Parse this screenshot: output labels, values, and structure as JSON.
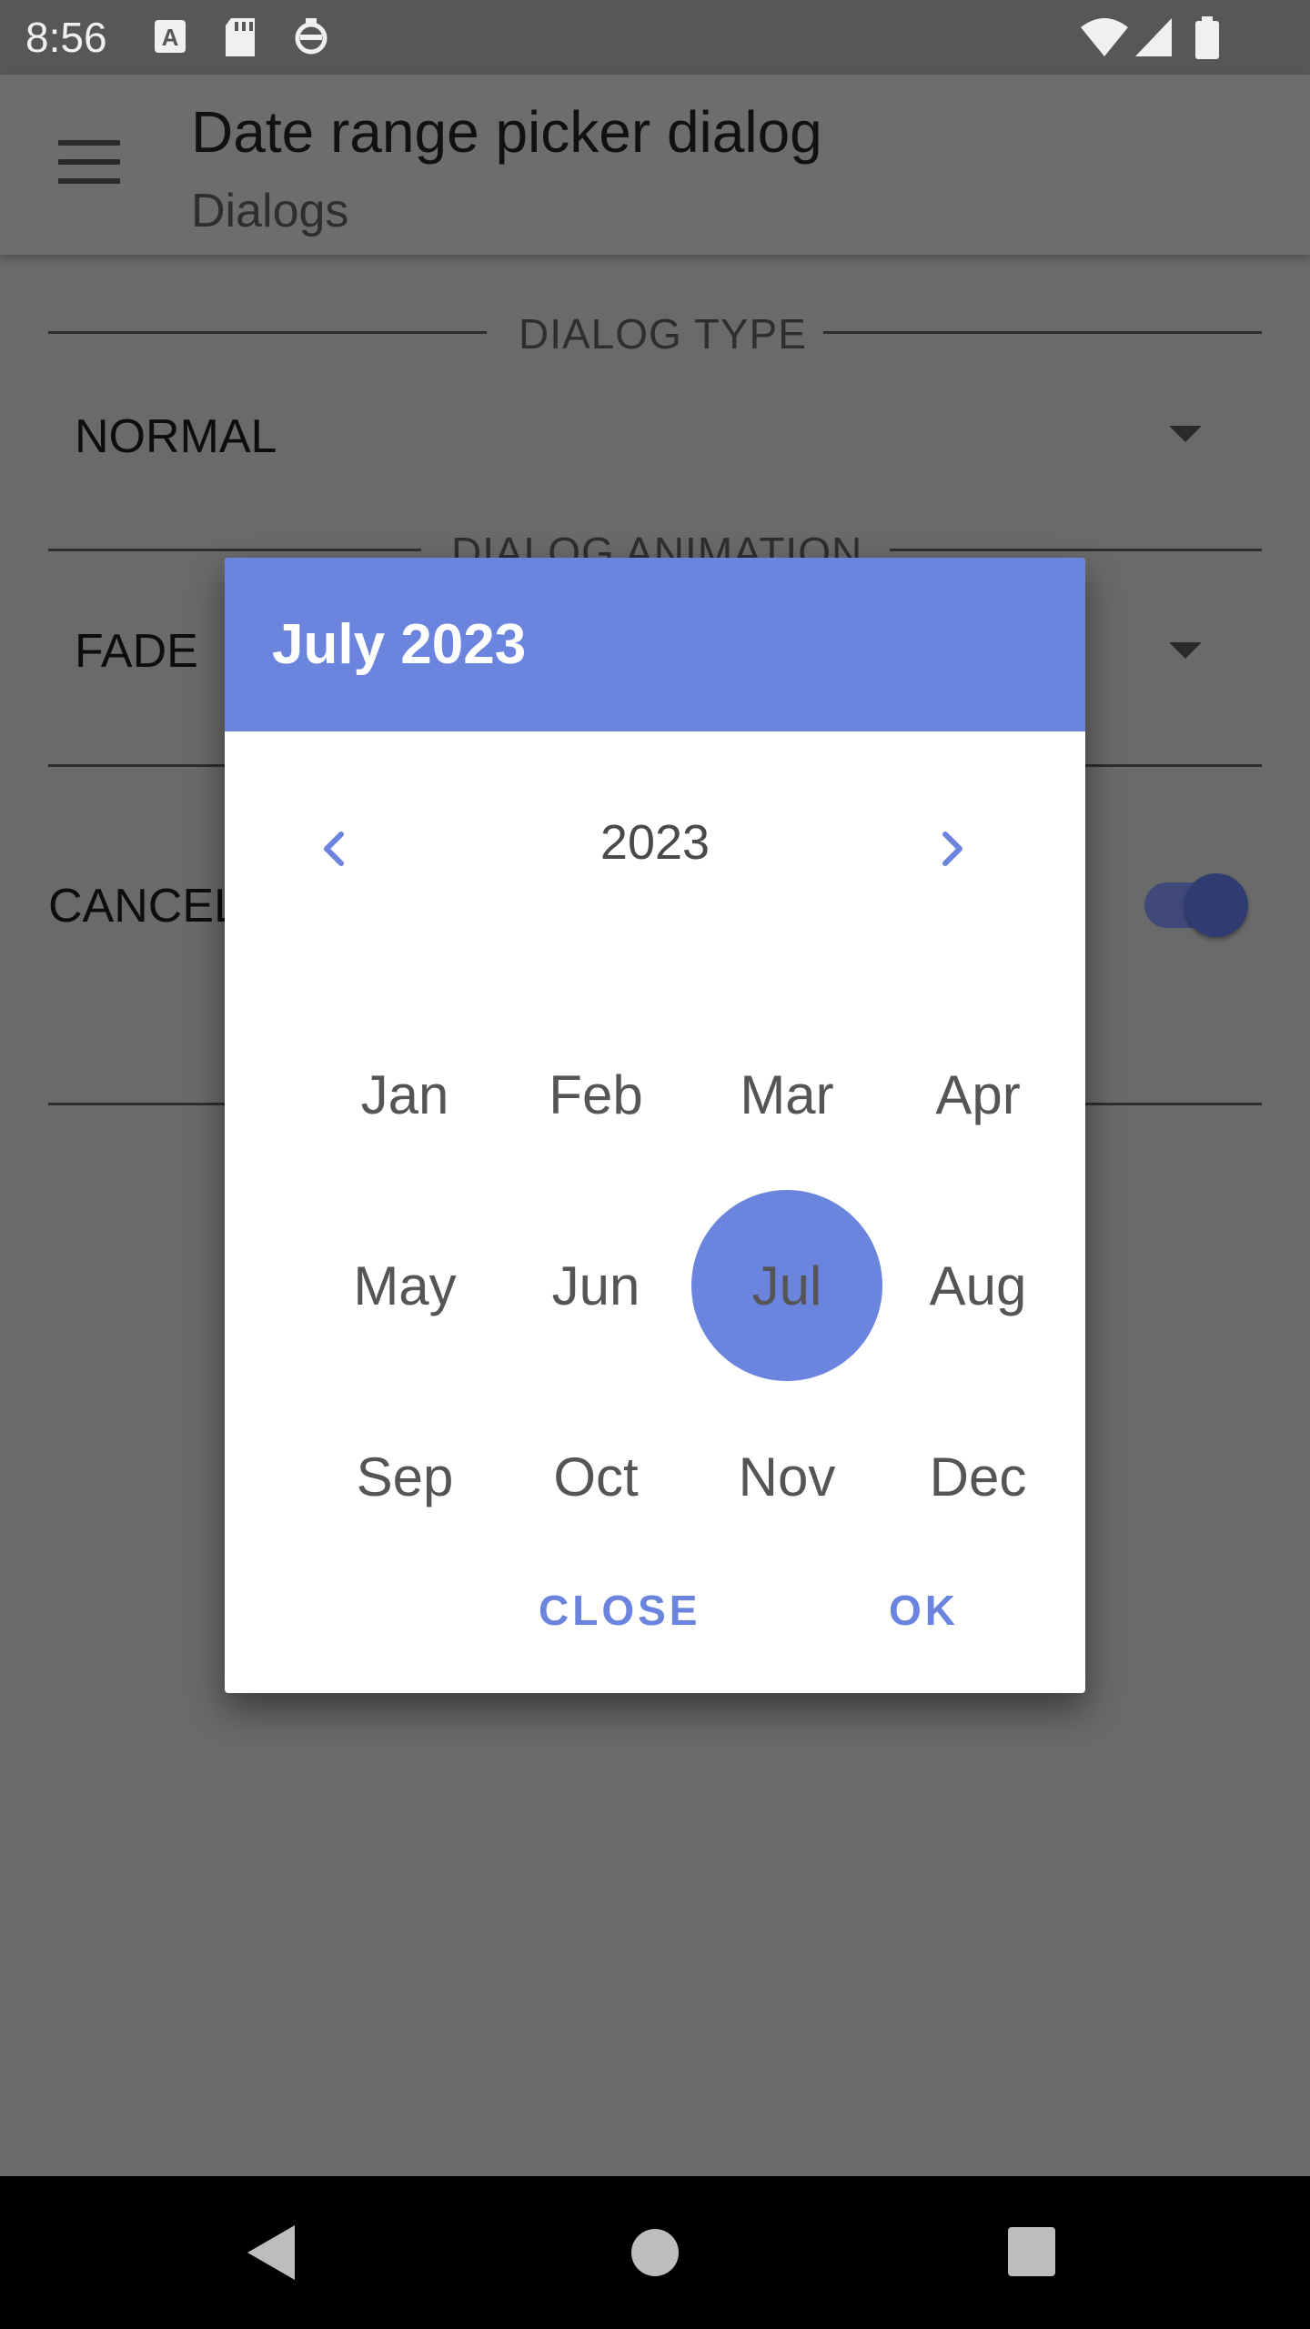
{
  "status_bar": {
    "time": "8:56",
    "icons": [
      "keyboard-a-icon",
      "sd-card-icon",
      "launcher-icon",
      "wifi-icon",
      "signal-icon",
      "battery-icon"
    ]
  },
  "app_bar": {
    "title": "Date range picker dialog",
    "subtitle": "Dialogs"
  },
  "form": {
    "dialog_type_label": "DIALOG TYPE",
    "dialog_type_value": "NORMAL",
    "dialog_animation_label": "DIALOG ANIMATION",
    "dialog_animation_value": "FADE",
    "cancel_label": "CANCEL",
    "cancel_toggle_on": true
  },
  "dialog": {
    "header_title": "July 2023",
    "year": "2023",
    "months": [
      "Jan",
      "Feb",
      "Mar",
      "Apr",
      "May",
      "Jun",
      "Jul",
      "Aug",
      "Sep",
      "Oct",
      "Nov",
      "Dec"
    ],
    "selected_month": "Jul",
    "close_label": "CLOSE",
    "ok_label": "OK"
  },
  "colors": {
    "accent": "#6b84de",
    "scrim": "#6a6a6a"
  }
}
